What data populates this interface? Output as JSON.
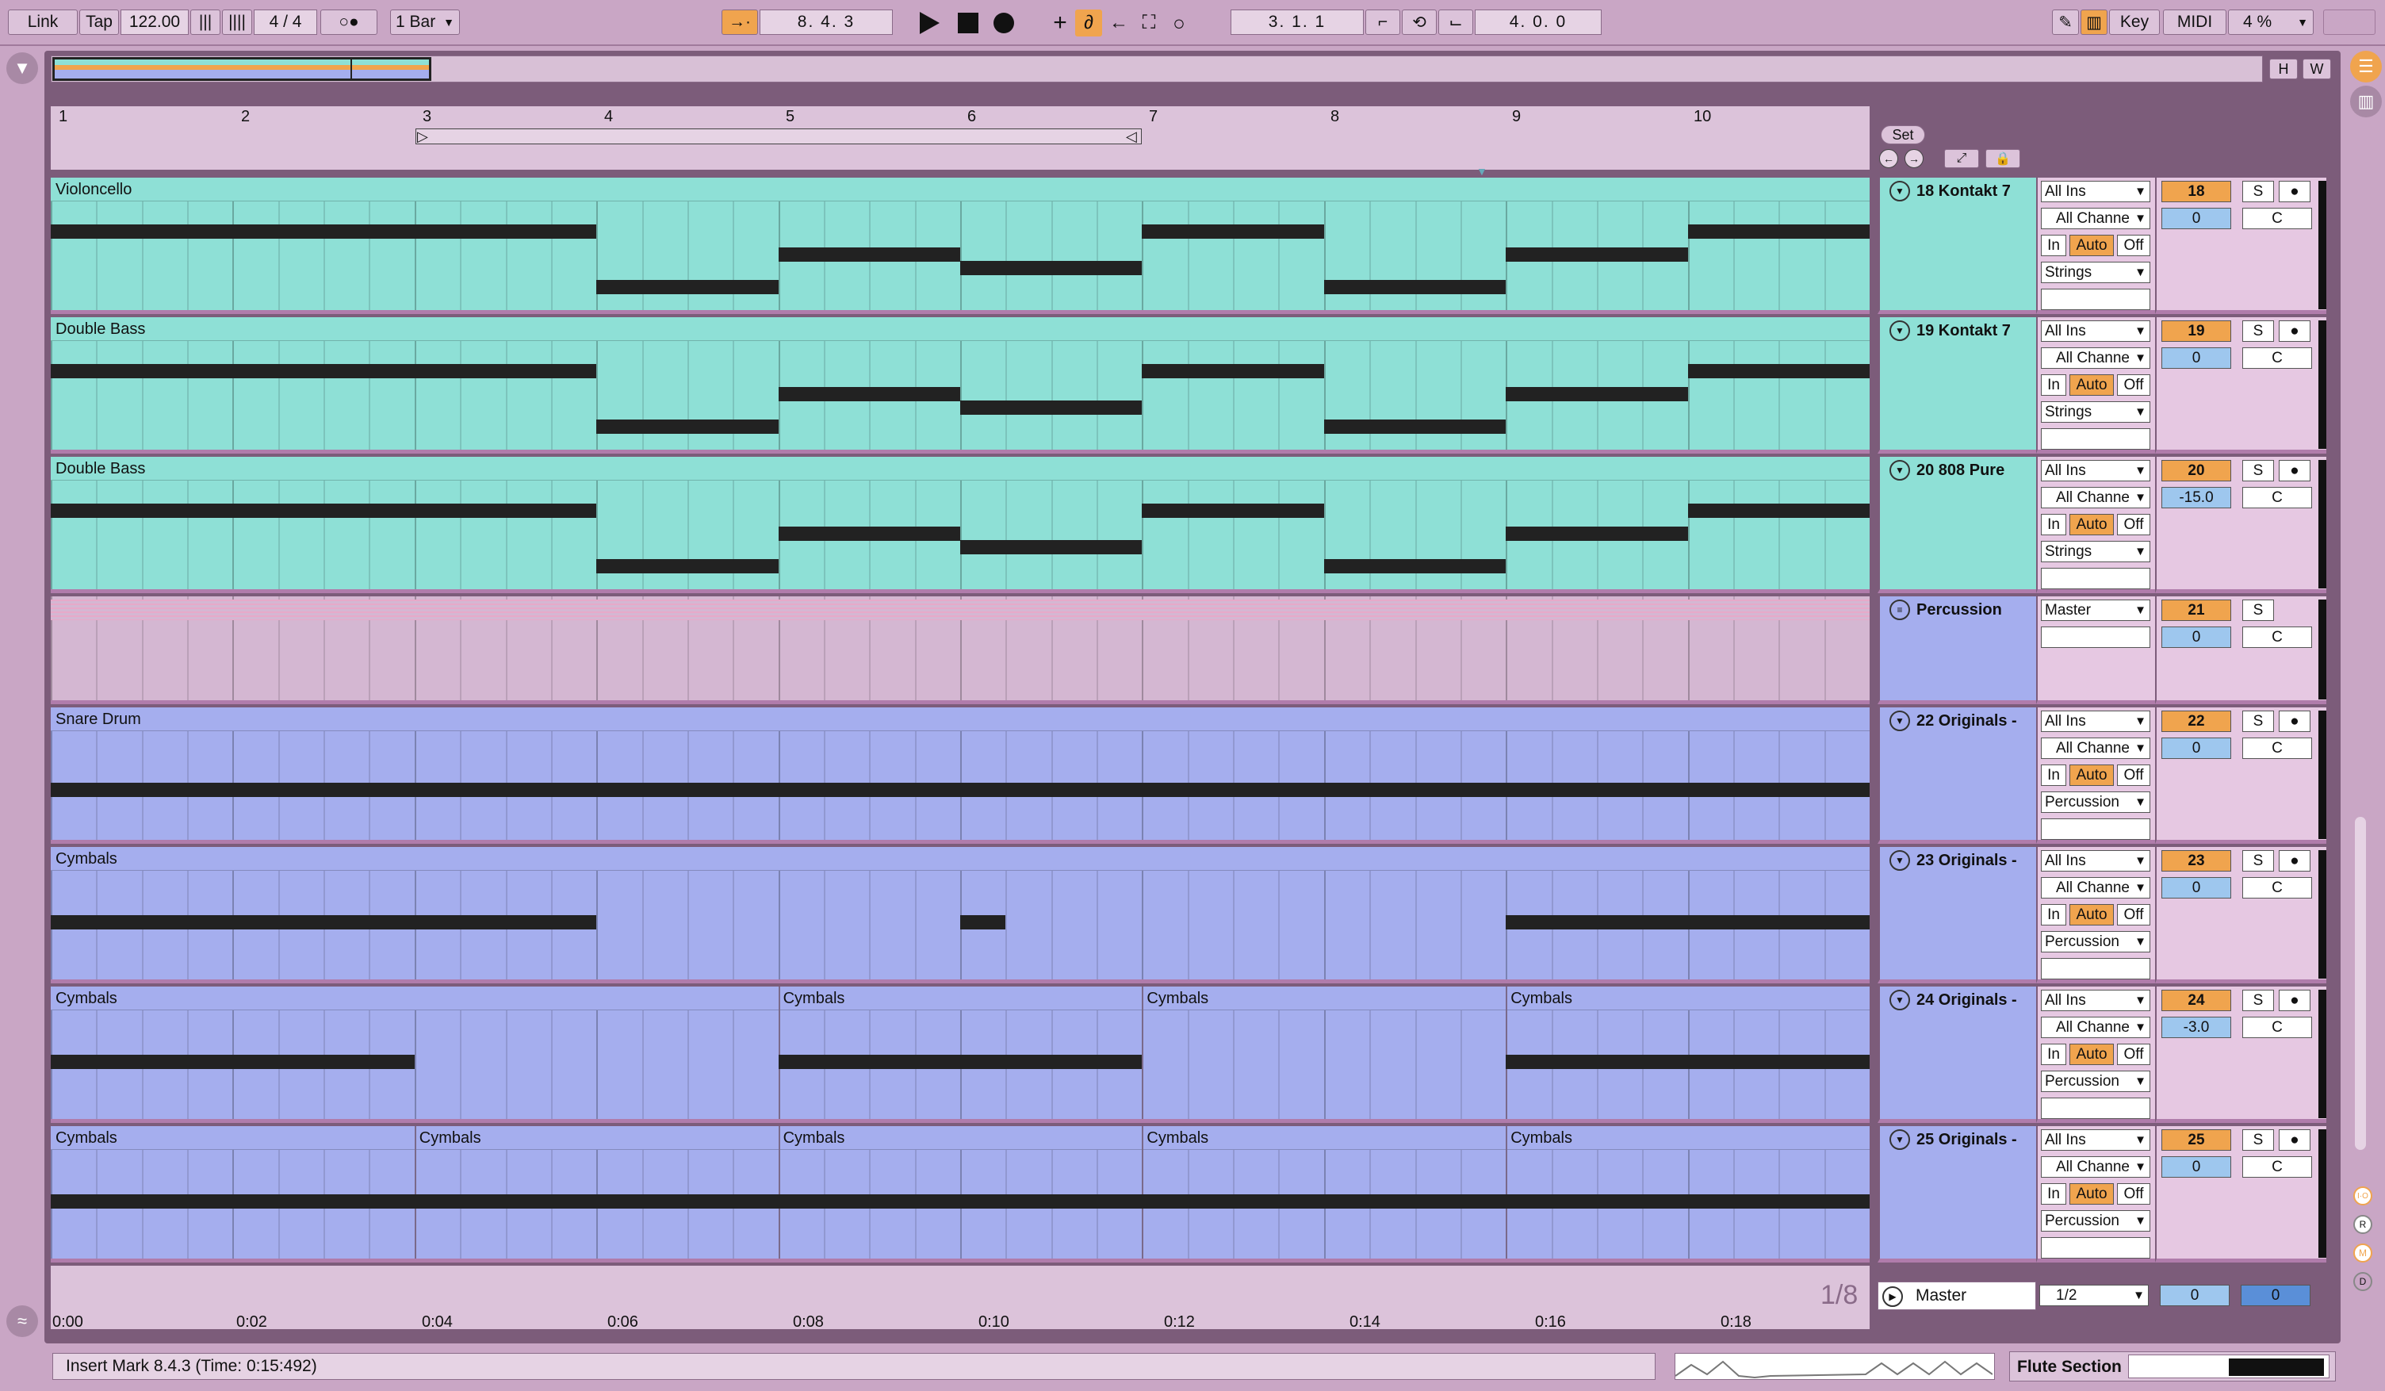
{
  "toolbar": {
    "link": "Link",
    "tap": "Tap",
    "tempo": "122.00",
    "signature": "4 / 4",
    "metro": "○●",
    "quantize": "1 Bar",
    "position": "8.   4.   3",
    "loop_start": "3.   1.   1",
    "loop_length": "4.   0.   0",
    "key": "Key",
    "midi": "MIDI",
    "cpu": "4 %"
  },
  "overview": {
    "h": "H",
    "w": "W"
  },
  "ruler": {
    "bars": [
      "1",
      "2",
      "3",
      "4",
      "5",
      "6",
      "7",
      "8",
      "9",
      "10"
    ],
    "set": "Set"
  },
  "time_ruler": {
    "labels": [
      "0:00",
      "0:02",
      "0:04",
      "0:06",
      "0:08",
      "0:10",
      "0:12",
      "0:14",
      "0:16",
      "0:18"
    ],
    "quant": "1/8"
  },
  "tracks": [
    {
      "clip": "Violoncello",
      "name": "18 Kontakt 7",
      "input": "All Ins",
      "channel": "All Channe",
      "monitor": [
        "In",
        "Auto",
        "Off"
      ],
      "output": "Strings",
      "num": "18",
      "vol": "0",
      "pan": "C",
      "solo": "S"
    },
    {
      "clip": "Double Bass",
      "name": "19 Kontakt 7",
      "input": "All Ins",
      "channel": "All Channe",
      "monitor": [
        "In",
        "Auto",
        "Off"
      ],
      "output": "Strings",
      "num": "19",
      "vol": "0",
      "pan": "C",
      "solo": "S"
    },
    {
      "clip": "Double Bass",
      "name": "20 808 Pure",
      "input": "All Ins",
      "channel": "All Channe",
      "monitor": [
        "In",
        "Auto",
        "Off"
      ],
      "output": "Strings",
      "num": "20",
      "vol": "-15.0",
      "pan": "C",
      "solo": "S"
    },
    {
      "clip": "",
      "name": "Percussion",
      "input": "Master",
      "num": "21",
      "vol": "0",
      "pan": "C",
      "solo": "S"
    },
    {
      "clip": "Snare Drum",
      "name": "22 Originals -",
      "input": "All Ins",
      "channel": "All Channe",
      "monitor": [
        "In",
        "Auto",
        "Off"
      ],
      "output": "Percussion",
      "num": "22",
      "vol": "0",
      "pan": "C",
      "solo": "S"
    },
    {
      "clip": "Cymbals",
      "name": "23 Originals -",
      "input": "All Ins",
      "channel": "All Channe",
      "monitor": [
        "In",
        "Auto",
        "Off"
      ],
      "output": "Percussion",
      "num": "23",
      "vol": "0",
      "pan": "C",
      "solo": "S"
    },
    {
      "clip": "Cymbals",
      "clips": [
        "Cymbals",
        "Cymbals",
        "Cymbals"
      ],
      "name": "24 Originals -",
      "input": "All Ins",
      "channel": "All Channe",
      "monitor": [
        "In",
        "Auto",
        "Off"
      ],
      "output": "Percussion",
      "num": "24",
      "vol": "-3.0",
      "pan": "C",
      "solo": "S"
    },
    {
      "clip": "Cymbals",
      "clips": [
        "Cymbals",
        "Cymbals",
        "Cymbals",
        "Cymbals"
      ],
      "name": "25 Originals -",
      "input": "All Ins",
      "channel": "All Channe",
      "monitor": [
        "In",
        "Auto",
        "Off"
      ],
      "output": "Percussion",
      "num": "25",
      "vol": "0",
      "pan": "C",
      "solo": "S"
    }
  ],
  "master": {
    "name": "Master",
    "routing": "1/2",
    "vol": "0",
    "pan": "0"
  },
  "status": {
    "message": "Insert Mark 8.4.3 (Time: 0:15:492)",
    "device": "Flute Section"
  },
  "side_icons": [
    "I·O",
    "R",
    "M",
    "D"
  ],
  "colors": {
    "midi": "#8ee0d6",
    "perc": "#a5aeee",
    "accent": "#f0a44e",
    "bg": "#c9a6c5"
  }
}
